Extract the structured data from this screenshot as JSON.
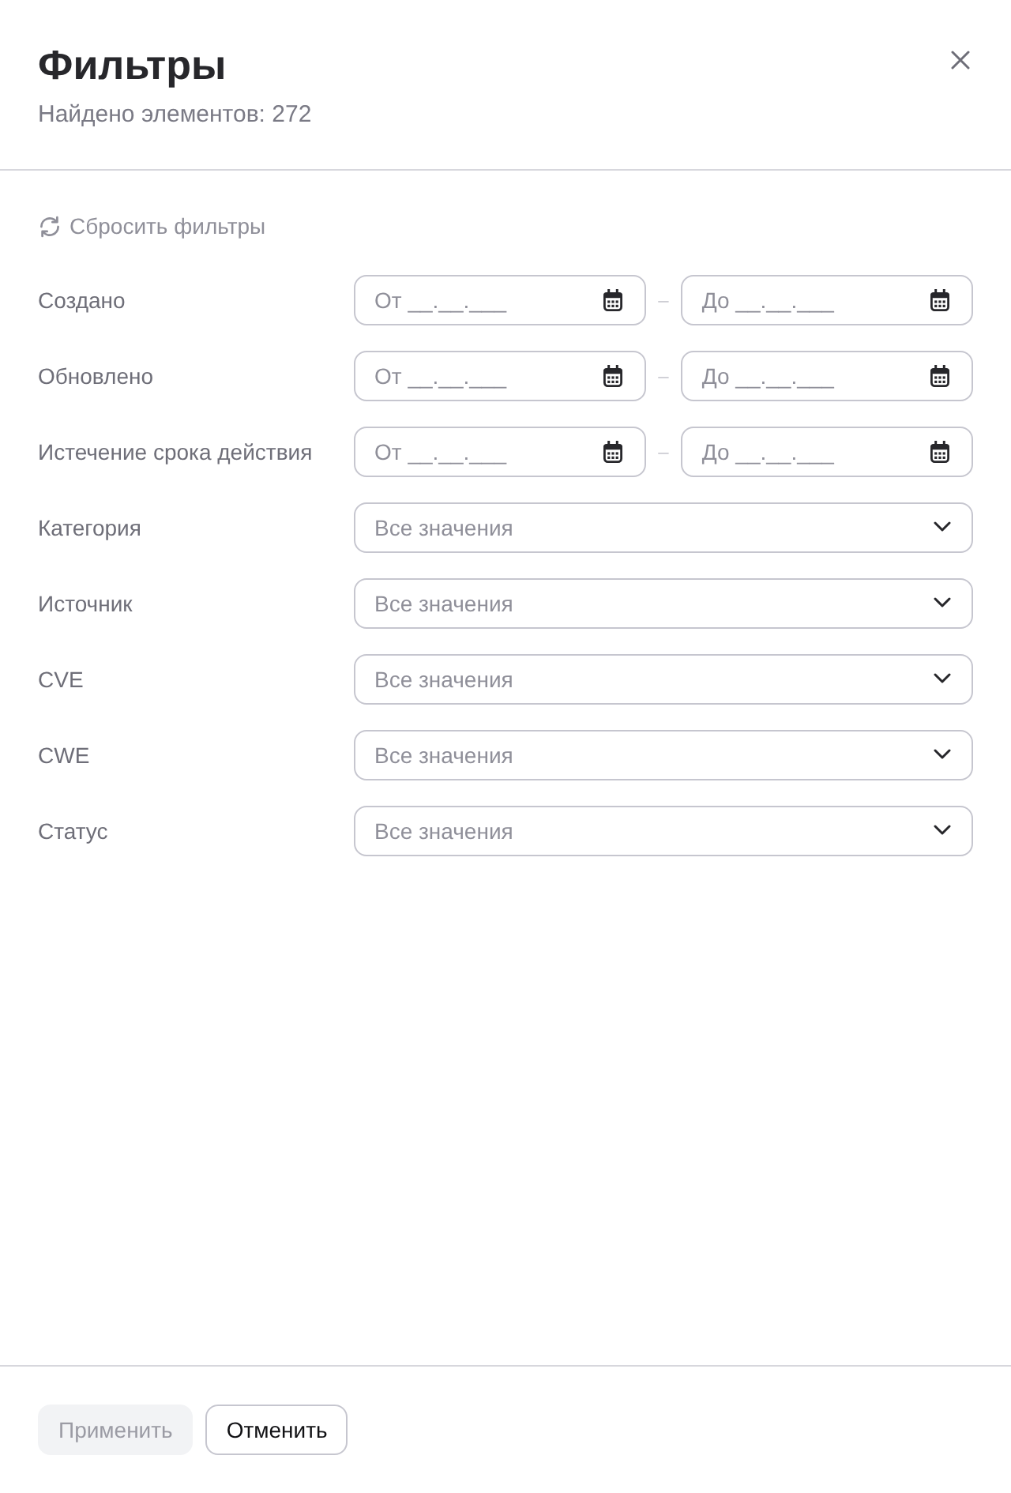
{
  "header": {
    "title": "Фильтры",
    "subtitle": "Найдено элементов: 272"
  },
  "reset": {
    "label": "Сбросить фильтры"
  },
  "filters": [
    {
      "kind": "date_range",
      "label": "Создано",
      "from": {
        "placeholder": "От __.__.___"
      },
      "separator": "–",
      "to": {
        "placeholder": "До __.__.___"
      }
    },
    {
      "kind": "date_range",
      "label": "Обновлено",
      "from": {
        "placeholder": "От __.__.___"
      },
      "separator": "–",
      "to": {
        "placeholder": "До __.__.___"
      }
    },
    {
      "kind": "date_range",
      "label": "Истечение срока действия",
      "from": {
        "placeholder": "От __.__.___"
      },
      "separator": "–",
      "to": {
        "placeholder": "До __.__.___"
      }
    },
    {
      "kind": "select",
      "label": "Категория",
      "placeholder": "Все значения"
    },
    {
      "kind": "select",
      "label": "Источник",
      "placeholder": "Все значения"
    },
    {
      "kind": "select",
      "label": "CVE",
      "placeholder": "Все значения"
    },
    {
      "kind": "select",
      "label": "CWE",
      "placeholder": "Все значения"
    },
    {
      "kind": "select",
      "label": "Статус",
      "placeholder": "Все значения"
    }
  ],
  "footer": {
    "buttons": [
      {
        "label": "Применить",
        "disabled": true
      },
      {
        "label": "Отменить",
        "disabled": false
      }
    ]
  }
}
